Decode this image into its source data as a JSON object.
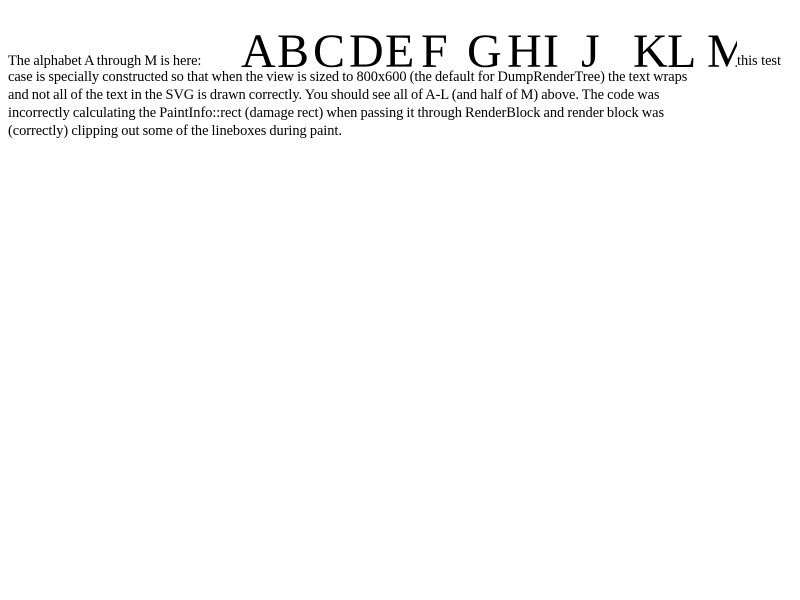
{
  "intro_text": "The alphabet A through M is here:",
  "svg_letters": [
    "A",
    "B",
    "C",
    "D",
    "E",
    "F",
    "G",
    "H",
    "I",
    "J",
    "K",
    "L",
    "M"
  ],
  "after_svg_text": "this test",
  "lines": [
    "case is specially constructed so that when the view is sized to 800x600 (the default for DumpRenderTree) the text wraps",
    "and not all of the text in the SVG is drawn correctly. You should see all of A-L (and half of M) above. The code was",
    "incorrectly calculating the PaintInfo::rect (damage rect) when passing it through RenderBlock and render block was",
    "(correctly) clipping out some of the lineboxes during paint."
  ]
}
